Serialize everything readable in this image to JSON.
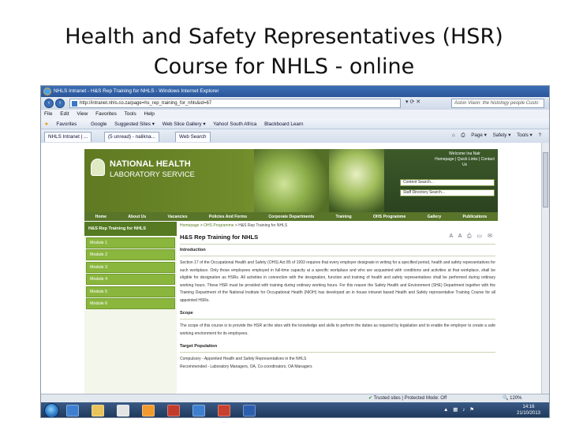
{
  "slide": {
    "title_line1": "Health and Safety Representatives (HSR)",
    "title_line2": "Course for NHLS - online"
  },
  "browser": {
    "window_title": "NHLS Intranet - H&S Rep Training for NHLS - Windows Internet Explorer",
    "url": "http://intranet.nhls.co.za/page=hs_rep_training_for_nhls&id=67",
    "search_placeholder": "Aston Vlaon: the histology people Custo",
    "menu": [
      "File",
      "Edit",
      "View",
      "Favorites",
      "Tools",
      "Help"
    ],
    "favorites": [
      "Favorites",
      "Google",
      "Suggested Sites ▾",
      "Web Slice Gallery ▾",
      "Yahoo! South Africa",
      "Blackboard Learn"
    ],
    "tabs": [
      "NHLS Intranet | ...",
      "(5 unread) - nalikna...",
      "Web Search"
    ],
    "toolbar_right": [
      "Page ▾",
      "Safety ▾",
      "Tools ▾",
      "?"
    ],
    "colors": {
      "ie_blue": "#2a5598",
      "nhls_green": "#58752a",
      "module_green": "#8ab63e"
    }
  },
  "site": {
    "logo_line1": "NATIONAL HEALTH",
    "logo_line2": "LABORATORY SERVICE",
    "welcome": "Welcome Ina Nair",
    "header_links": "Homepage | Quick Links | Contact Us",
    "content_search": "Content Search...",
    "staff_search": "Staff Directory Search...",
    "nav": [
      "Home",
      "About Us",
      "Vacancies",
      "Policies And Forms",
      "Corporate Departments",
      "Training",
      "OHS Programme",
      "Gallery",
      "Publications"
    ],
    "sidebar_header": "H&S Rep Training for NHLS",
    "modules": [
      "Module 1",
      "Module 2",
      "Module 3",
      "Module 4",
      "Module 5",
      "Module 6"
    ],
    "breadcrumb": {
      "home": "Homepage",
      "section": "OHS Programme",
      "current": "H&S Rep Training for NHLS",
      "sep": " > "
    },
    "page_title": "H&S Rep Training for NHLS",
    "intro_heading": "Introduction",
    "intro_text": "Section 17 of the Occupational Health and Safety (OHS) Act 85 of 1993 requires that every employer designate in writing for a specified period, health and safety representatives for such workplace. Only those employees employed in full-time capacity at a specific workplace and who are acquainted with conditions and activities at that workplace, shall be eligible for designation as HSRs. All activities in connection with the designation, function and training of health and safety representatives shall be performed during ordinary working hours. These HSR must be provided with training during ordinary working hours. For this reason the Safety Health and Environment (SHE) Department together with the Training Department of the National Institute for Occupational Health (NIOH) has developed an in house intranet based Health and Safety representative Training Course for all appointed HSRs.",
    "scope_heading": "Scope",
    "scope_text": "The scope of this course is to provide the HSR at the sites with the knowledge and skills to perform the duties as required by legislation and to enable the employer to create a safe working environment for its employees.",
    "target_heading": "Target Population",
    "target_text1": "Compulsory - Appointed Health and Safety Representatives in the NHLS",
    "target_text2": "Recommended - Laboratory Managers, OA, Co-coordinators, OA Managers"
  },
  "status": {
    "trusted": "Trusted sites | Protected Mode: Off",
    "zoom": "120%"
  },
  "taskbar": {
    "time": "14:16",
    "date": "21/10/2013",
    "icon_colors": [
      "#3f7fd0",
      "#e8c45a",
      "#e4e4e4",
      "#f29a2e",
      "#c23b2b",
      "#3f7fd0",
      "#c8402e",
      "#2b5fae"
    ]
  }
}
